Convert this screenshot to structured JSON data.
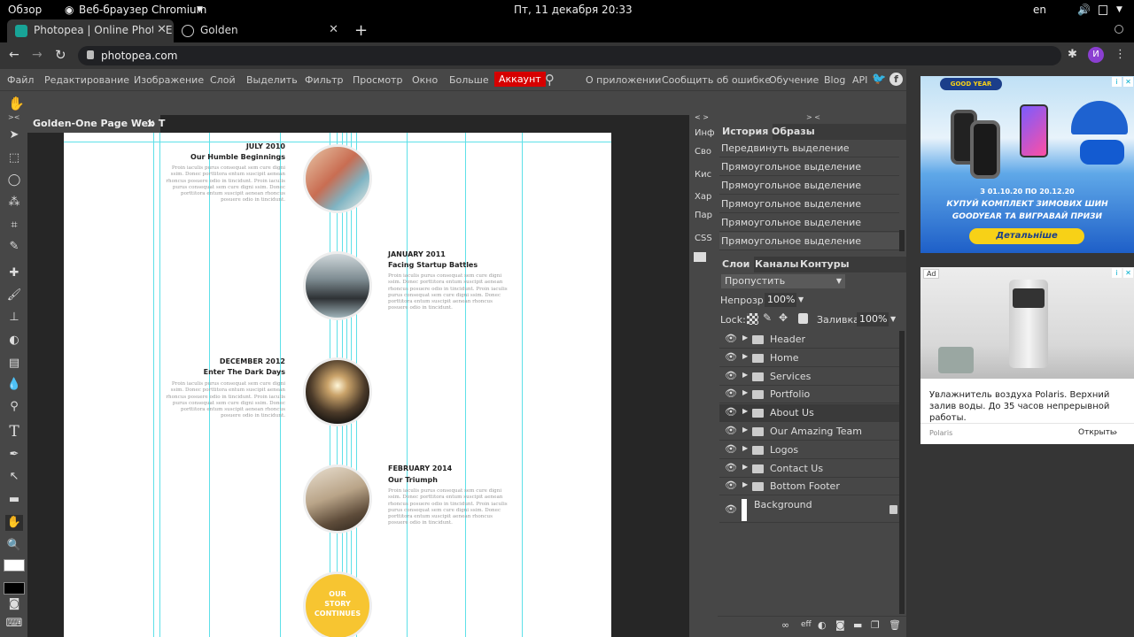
{
  "system_bar": {
    "activities": "Обзор",
    "app": "Веб-браузер Chromium",
    "clock": "Пт, 11 декабря  20:33",
    "lang": "en"
  },
  "browser": {
    "tabs": [
      {
        "title": "Photopea | Online Photo E",
        "close": "✕"
      },
      {
        "title": "Golden",
        "close": "✕"
      }
    ],
    "new_tab": "+",
    "url": "photopea.com",
    "profile_initial": "И"
  },
  "menu": {
    "items": [
      "Файл",
      "Редактирование",
      "Изображение",
      "Слой",
      "Выделить",
      "Фильтр",
      "Просмотр",
      "Окно",
      "Больше"
    ],
    "account": "Аккаунт",
    "right_links": [
      "О приложении",
      "Сообщить об ошибке",
      "Обучение",
      "Blog",
      "API"
    ]
  },
  "document": {
    "tab_title": "Golden-One Page Web T",
    "close": "✕",
    "timeline": [
      {
        "date": "JULY 2010",
        "title": "Our Humble Beginnings",
        "side": "left"
      },
      {
        "date": "JANUARY 2011",
        "title": "Facing Startup Battles",
        "side": "right"
      },
      {
        "date": "DECEMBER 2012",
        "title": "Enter The Dark Days",
        "side": "left"
      },
      {
        "date": "FEBRUARY 2014",
        "title": "Our Triumph",
        "side": "right"
      }
    ],
    "body_text": "Proin iaculis purus consequat sem cure digni ssim. Donec porttitora entum suscipit aenean rhoncus posuere odio in tincidunt. Proin iaculis purus consequat sem cure digni ssim. Donec porttitora entum suscipit aenean rhoncus posuere odio in tincidunt.",
    "final_circle": [
      "OUR",
      "STORY",
      "CONTINUES"
    ]
  },
  "collapsed_panel": {
    "toggle": "< >",
    "items": [
      "Инф",
      "Сво",
      "Кис",
      "Хар",
      "Пар",
      "CSS"
    ]
  },
  "history_panel": {
    "toggle": "> <",
    "tabs": [
      "История",
      "Образы"
    ],
    "items": [
      "Передвинуть выделение",
      "Прямоугольное выделение",
      "Прямоугольное выделение",
      "Прямоугольное выделение",
      "Прямоугольное выделение",
      "Прямоугольное выделение"
    ]
  },
  "layers_panel": {
    "tabs": [
      "Слои",
      "Каналы",
      "Контуры"
    ],
    "blend_mode": "Пропустить",
    "opacity_label": "Непрозр.:",
    "opacity": "100%",
    "lock_label": "Lock:",
    "fill_label": "Заливка:",
    "fill": "100%",
    "groups": [
      "Header",
      "Home",
      "Services",
      "Portfolio",
      "About Us",
      "Our Amazing Team",
      "Logos",
      "Contact Us",
      "Bottom Footer"
    ],
    "background": "Background",
    "footer_eff": "eff"
  },
  "ads": {
    "ad1": {
      "line1": "З 01.10.20 ПО 20.12.20",
      "line2": "КУПУЙ КОМПЛЕКТ ЗИМОВИХ ШИН",
      "line3": "GOODYEAR ТА ВИГРАВАЙ ПРИЗИ",
      "button": "Детальніше",
      "brand": "GOOD YEAR"
    },
    "ad2": {
      "badge": "Ad",
      "text": "Увлажнитель воздуха Polaris. Верхний залив воды. До 35 часов непрерывной работы.",
      "advertiser": "Polaris",
      "cta": "Открыть"
    }
  },
  "colors": {
    "guide": "#5ee0e8",
    "accent_yellow": "#f7c531",
    "account_red": "#d60000"
  }
}
